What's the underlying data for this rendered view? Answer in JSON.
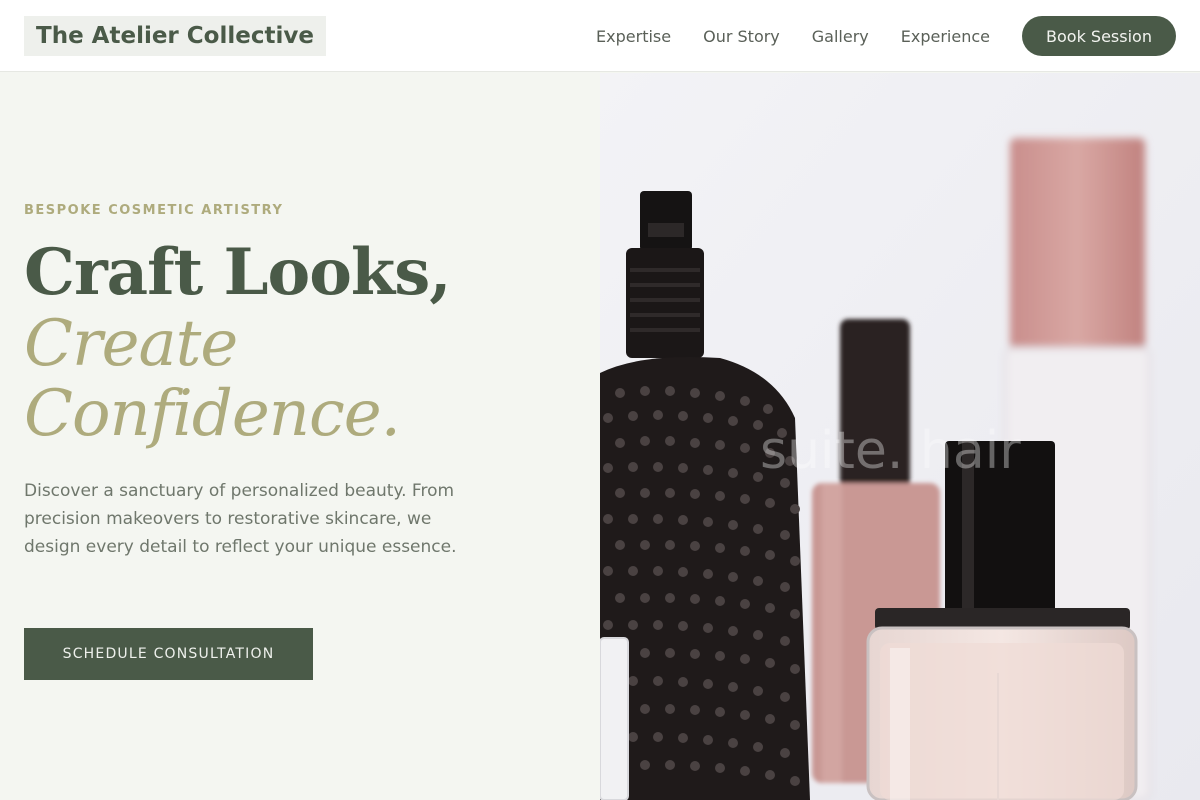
{
  "header": {
    "logo": "The Atelier Collective",
    "nav": [
      "Expertise",
      "Our Story",
      "Gallery",
      "Experience"
    ],
    "book_label": "Book Session"
  },
  "hero": {
    "eyebrow": "BESPOKE COSMETIC ARTISTRY",
    "headline": "Craft Looks,",
    "headline_em_1": "Create",
    "headline_em_2": "Confidence.",
    "description": "Discover a sanctuary of personalized beauty. From precision makeovers to restorative skincare, we design every detail to reflect your unique essence.",
    "cta_label": "SCHEDULE CONSULTATION",
    "image_watermark": "suite. hair"
  },
  "colors": {
    "primary": "#4a5a48",
    "accent": "#aeab7d",
    "background": "#f4f6f1"
  }
}
